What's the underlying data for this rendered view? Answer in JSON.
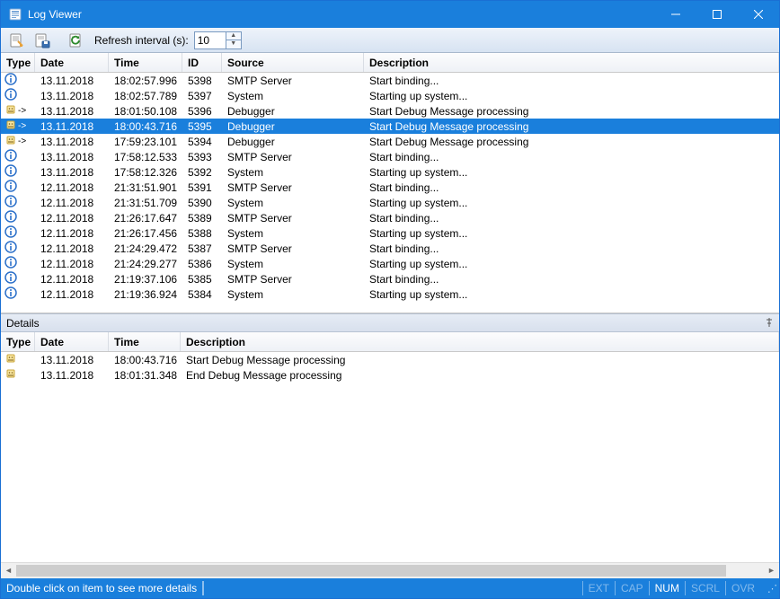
{
  "window": {
    "title": "Log Viewer"
  },
  "toolbar": {
    "refresh_label": "Refresh interval (s):",
    "refresh_value": "10"
  },
  "columns_top": {
    "type": "Type",
    "date": "Date",
    "time": "Time",
    "id": "ID",
    "source": "Source",
    "description": "Description"
  },
  "columns_bottom": {
    "type": "Type",
    "date": "Date",
    "time": "Time",
    "description": "Description"
  },
  "rows": [
    {
      "icon": "info",
      "arrow": false,
      "date": "13.11.2018",
      "time": "18:02:57.996",
      "id": "5398",
      "source": "SMTP Server",
      "desc": "Start binding...",
      "selected": false
    },
    {
      "icon": "info",
      "arrow": false,
      "date": "13.11.2018",
      "time": "18:02:57.789",
      "id": "5397",
      "source": "System",
      "desc": "Starting up system...",
      "selected": false
    },
    {
      "icon": "bug",
      "arrow": true,
      "date": "13.11.2018",
      "time": "18:01:50.108",
      "id": "5396",
      "source": "Debugger",
      "desc": "Start Debug Message processing",
      "selected": false
    },
    {
      "icon": "bug",
      "arrow": true,
      "date": "13.11.2018",
      "time": "18:00:43.716",
      "id": "5395",
      "source": "Debugger",
      "desc": "Start Debug Message processing",
      "selected": true
    },
    {
      "icon": "bug",
      "arrow": true,
      "date": "13.11.2018",
      "time": "17:59:23.101",
      "id": "5394",
      "source": "Debugger",
      "desc": "Start Debug Message processing",
      "selected": false
    },
    {
      "icon": "info",
      "arrow": false,
      "date": "13.11.2018",
      "time": "17:58:12.533",
      "id": "5393",
      "source": "SMTP Server",
      "desc": "Start binding...",
      "selected": false
    },
    {
      "icon": "info",
      "arrow": false,
      "date": "13.11.2018",
      "time": "17:58:12.326",
      "id": "5392",
      "source": "System",
      "desc": "Starting up system...",
      "selected": false
    },
    {
      "icon": "info",
      "arrow": false,
      "date": "12.11.2018",
      "time": "21:31:51.901",
      "id": "5391",
      "source": "SMTP Server",
      "desc": "Start binding...",
      "selected": false
    },
    {
      "icon": "info",
      "arrow": false,
      "date": "12.11.2018",
      "time": "21:31:51.709",
      "id": "5390",
      "source": "System",
      "desc": "Starting up system...",
      "selected": false
    },
    {
      "icon": "info",
      "arrow": false,
      "date": "12.11.2018",
      "time": "21:26:17.647",
      "id": "5389",
      "source": "SMTP Server",
      "desc": "Start binding...",
      "selected": false
    },
    {
      "icon": "info",
      "arrow": false,
      "date": "12.11.2018",
      "time": "21:26:17.456",
      "id": "5388",
      "source": "System",
      "desc": "Starting up system...",
      "selected": false
    },
    {
      "icon": "info",
      "arrow": false,
      "date": "12.11.2018",
      "time": "21:24:29.472",
      "id": "5387",
      "source": "SMTP Server",
      "desc": "Start binding...",
      "selected": false
    },
    {
      "icon": "info",
      "arrow": false,
      "date": "12.11.2018",
      "time": "21:24:29.277",
      "id": "5386",
      "source": "System",
      "desc": "Starting up system...",
      "selected": false
    },
    {
      "icon": "info",
      "arrow": false,
      "date": "12.11.2018",
      "time": "21:19:37.106",
      "id": "5385",
      "source": "SMTP Server",
      "desc": "Start binding...",
      "selected": false
    },
    {
      "icon": "info",
      "arrow": false,
      "date": "12.11.2018",
      "time": "21:19:36.924",
      "id": "5384",
      "source": "System",
      "desc": "Starting up system...",
      "selected": false
    }
  ],
  "details_caption": "Details",
  "detail_rows": [
    {
      "icon": "bug",
      "date": "13.11.2018",
      "time": "18:00:43.716",
      "desc": "Start Debug Message processing"
    },
    {
      "icon": "bug",
      "date": "13.11.2018",
      "time": "18:01:31.348",
      "desc": "End Debug Message processing"
    }
  ],
  "status": {
    "msg": "Double click on item to see more details",
    "indicators": {
      "ext": "EXT",
      "cap": "CAP",
      "num": "NUM",
      "scrl": "SCRL",
      "ovr": "OVR"
    }
  }
}
